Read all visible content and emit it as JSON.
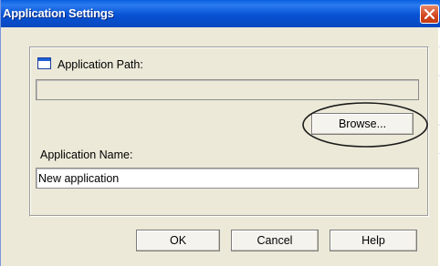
{
  "window": {
    "title": "Application Settings",
    "close_icon": "close-icon"
  },
  "form": {
    "path_icon": "window-icon",
    "path_label": "Application Path:",
    "path_value": "",
    "browse_label": "Browse...",
    "name_label": "Application Name:",
    "name_value": "New application"
  },
  "buttons": {
    "ok_label": "OK",
    "cancel_label": "Cancel",
    "help_label": "Help"
  },
  "colors": {
    "titlebar": "#0752d3",
    "dialog_bg": "#ece9d8",
    "close_button": "#d2441d"
  }
}
